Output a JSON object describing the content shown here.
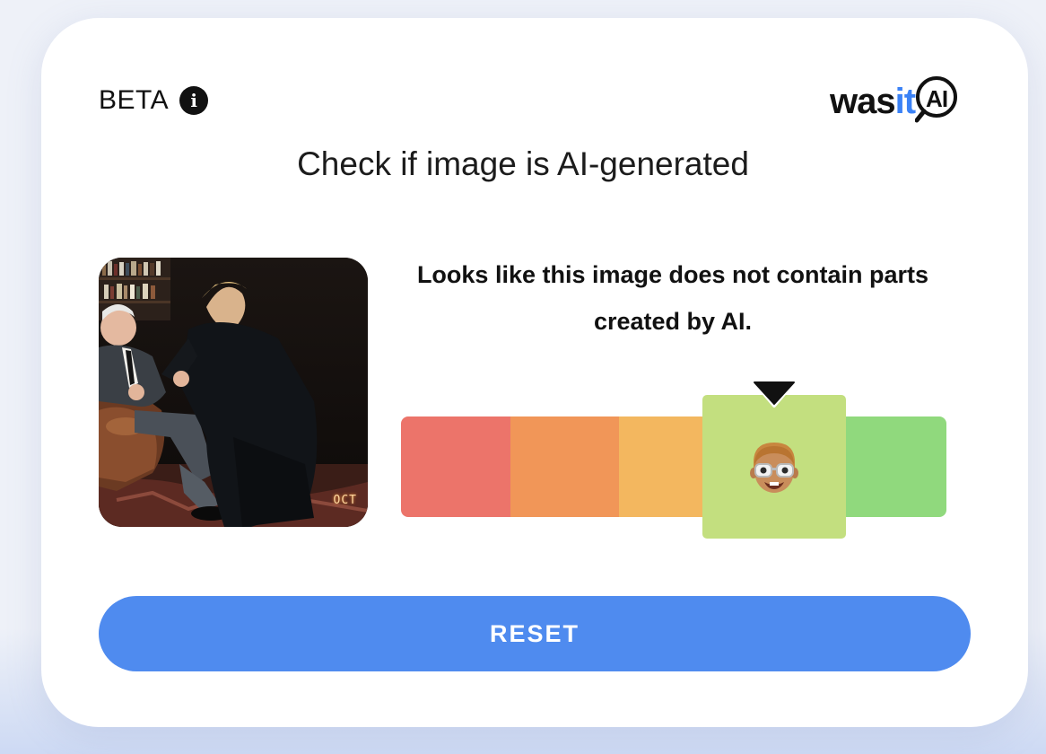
{
  "header": {
    "beta_label": "BETA",
    "info_icon": "info-icon"
  },
  "logo": {
    "part1": "was",
    "part2": "it",
    "part3": "AI",
    "accent_color": "#3b82f6"
  },
  "headline": "Check if image is AI-generated",
  "photo": {
    "icon": "uploaded-photo",
    "stamp": "OCT"
  },
  "result": {
    "message": "Looks like this image does not contain parts created by AI.",
    "level_index": 3,
    "level_count": 5,
    "segment_colors": [
      "#ec746a",
      "#f19658",
      "#f3b75f",
      "#c3df7f",
      "#90d97d"
    ],
    "indicator_icon": "nerd-face-emoji-icon"
  },
  "actions": {
    "reset_label": "RESET",
    "accent_color": "#4f8bef"
  }
}
